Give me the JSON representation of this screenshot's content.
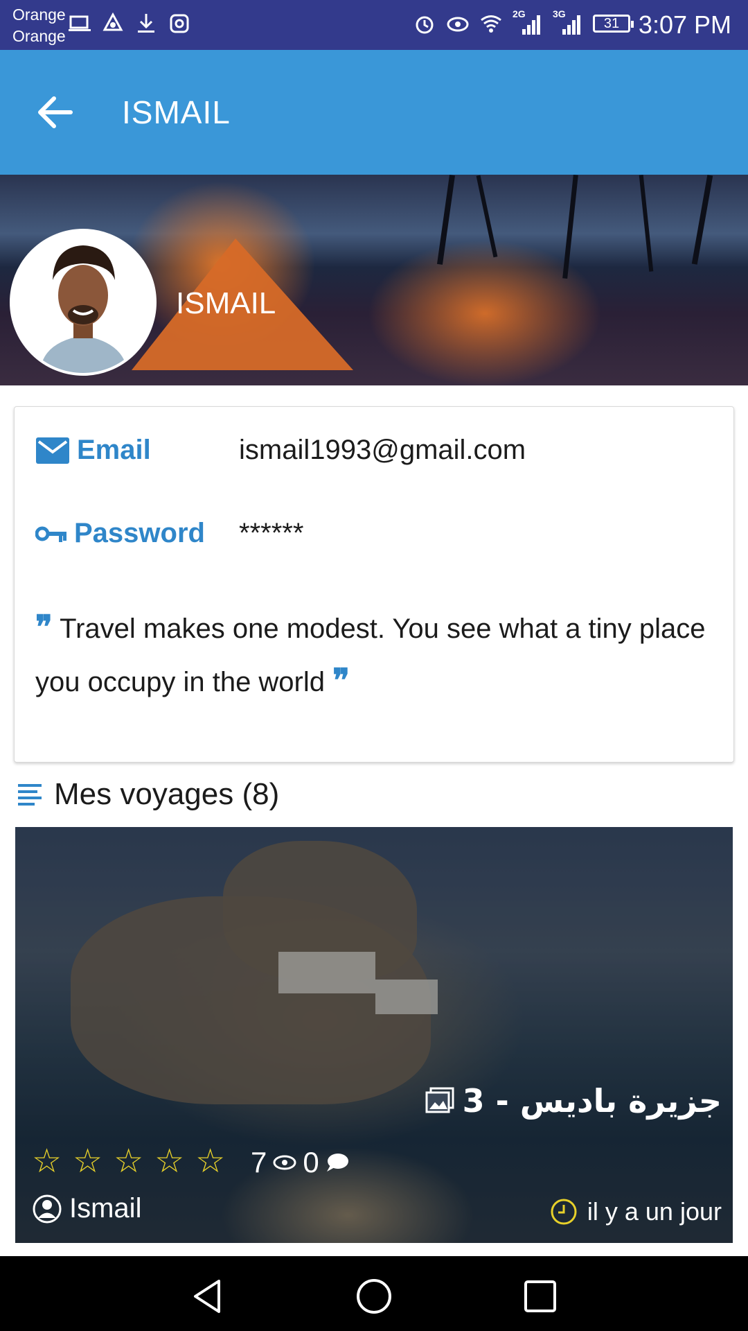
{
  "status_bar": {
    "carrier_line1": "Orange",
    "carrier_line2": "Orange",
    "left_icons": [
      "laptop-icon",
      "recycle-icon",
      "download-icon",
      "instagram-icon"
    ],
    "right_icons": [
      "alarm-icon",
      "eye-icon",
      "wifi-icon",
      "signal-2g-icon",
      "signal-3g-icon"
    ],
    "net1": "2G",
    "net2": "3G",
    "battery": "31",
    "time": "3:07 PM"
  },
  "app_bar": {
    "title": "ISMAIL"
  },
  "profile": {
    "name": "ISMAIL",
    "email_label": "Email",
    "email_value": "ismail1993@gmail.com",
    "password_label": "Password",
    "password_value": "******",
    "quote": "Travel makes one modest. You see what a tiny place you occupy in the world"
  },
  "trips_section": {
    "title": "Mes voyages (8)"
  },
  "trip": {
    "title": "جزيرة باديس - 3",
    "rating": 0,
    "rating_max": 5,
    "views": "7",
    "comments": "0",
    "author": "Ismail",
    "time": "il y a un jour"
  },
  "colors": {
    "status_bar": "#333a8c",
    "app_bar": "#3a97d8",
    "accent": "#2f86c9",
    "star": "#e8d12a"
  }
}
